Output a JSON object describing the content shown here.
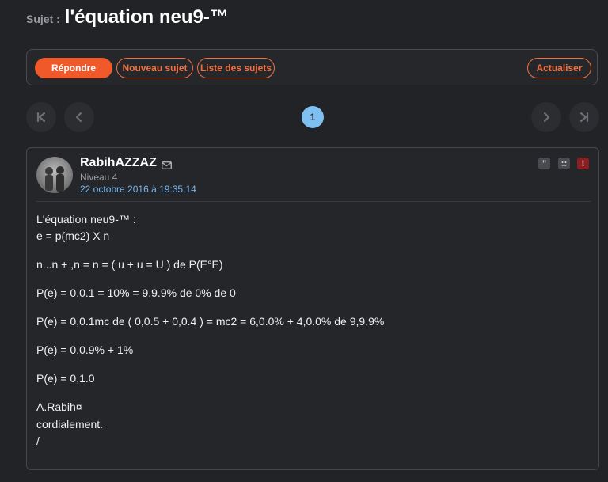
{
  "topic": {
    "prefix": "Sujet :",
    "title": "l'équation neu9-™"
  },
  "toolbar": {
    "reply": "Répondre",
    "new_topic": "Nouveau sujet",
    "topic_list": "Liste des sujets",
    "refresh": "Actualiser"
  },
  "pagination": {
    "current_page": "1",
    "icons": [
      "first-page-icon",
      "prev-page-icon",
      "next-page-icon",
      "last-page-icon"
    ]
  },
  "post": {
    "author": "RabihAZZAZ",
    "rank": "Niveau 4",
    "date": "22 octobre 2016 à 19:35:14",
    "actions": [
      "quote-icon",
      "sad-face-icon",
      "report-icon"
    ],
    "lines": [
      "L'équation neu9-™ :",
      "e = p(mc2) X n",
      "n...n + ,n = n = ( u + u = U ) de P(E°E)",
      "P(e) = 0,0.1 = 10% = 9,9.9% de 0% de 0",
      "P(e) = 0,0.1mc de ( 0,0.5 + 0,0.4 ) = mc2 = 6,0.0% + 4,0.0% de 9,9.9%",
      "P(e) = 0,0.9% + 1%",
      "P(e) = 0,1.0",
      "A.Rabih¤",
      "cordialement.",
      "/"
    ]
  },
  "colors": {
    "background": "#222327",
    "accent": "#f05a2a",
    "link": "#78b7ee",
    "page_current": "#7fc0f2",
    "report": "#8a1f22"
  }
}
